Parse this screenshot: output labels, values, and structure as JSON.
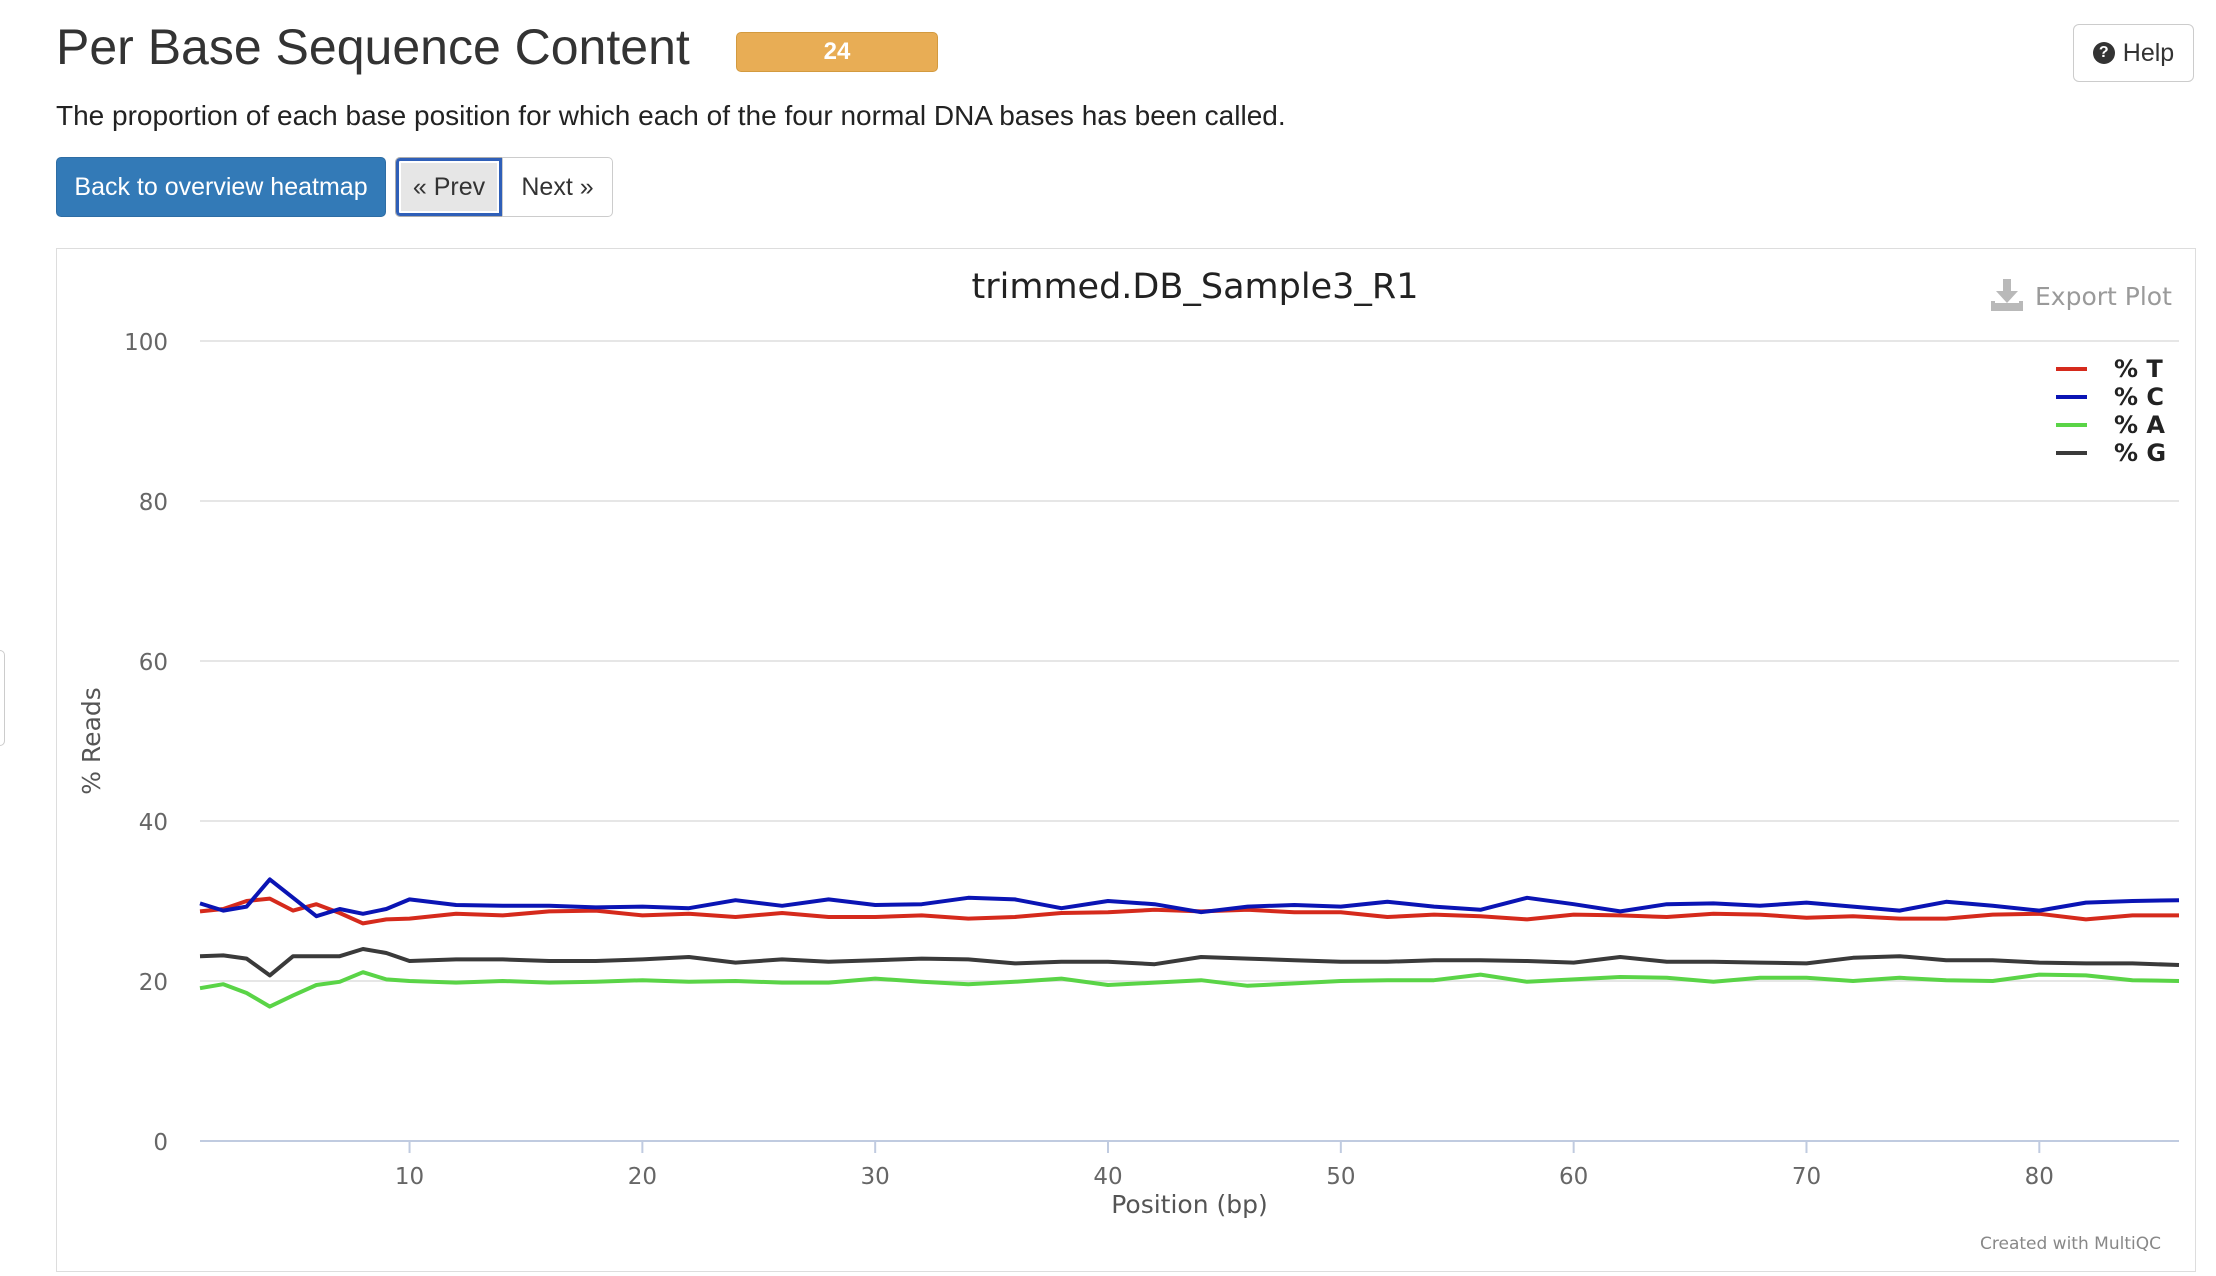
{
  "header": {
    "title": "Per Base Sequence Content",
    "badge": "24",
    "help_label": "Help",
    "description": "The proportion of each base position for which each of the four normal DNA bases has been called."
  },
  "nav": {
    "back_label": "Back to overview heatmap",
    "prev_label": "« Prev",
    "next_label": "Next »"
  },
  "plot": {
    "export_label": "Export Plot",
    "credit": "Created with MultiQC"
  },
  "colors": {
    "T": "#d52a1c",
    "C": "#0a14b4",
    "A": "#5ad447",
    "G": "#3a3a3a"
  },
  "chart_data": {
    "type": "line",
    "title": "trimmed.DB_Sample3_R1",
    "xlabel": "Position (bp)",
    "ylabel": "% Reads",
    "xlim": [
      1,
      86
    ],
    "ylim": [
      0,
      100
    ],
    "xticks": [
      10,
      20,
      30,
      40,
      50,
      60,
      70,
      80
    ],
    "yticks": [
      0,
      20,
      40,
      60,
      80,
      100
    ],
    "grid": true,
    "legend_position": "top-right",
    "x": [
      1,
      2,
      3,
      4,
      5,
      6,
      7,
      8,
      9,
      10,
      12,
      14,
      16,
      18,
      20,
      22,
      24,
      26,
      28,
      30,
      32,
      34,
      36,
      38,
      40,
      42,
      44,
      46,
      48,
      50,
      52,
      54,
      56,
      58,
      60,
      62,
      64,
      66,
      68,
      70,
      72,
      74,
      76,
      78,
      80,
      82,
      84,
      86
    ],
    "series": [
      {
        "name": "% T",
        "color_key": "T",
        "values": [
          28.7,
          29.0,
          30.0,
          30.3,
          28.8,
          29.6,
          28.5,
          27.2,
          27.7,
          27.8,
          28.4,
          28.2,
          28.7,
          28.8,
          28.2,
          28.4,
          28.0,
          28.5,
          28.0,
          28.0,
          28.2,
          27.8,
          28.0,
          28.5,
          28.6,
          28.9,
          28.7,
          28.9,
          28.6,
          28.6,
          28.0,
          28.3,
          28.1,
          27.7,
          28.3,
          28.2,
          28.0,
          28.4,
          28.3,
          27.9,
          28.1,
          27.8,
          27.8,
          28.3,
          28.4,
          27.7,
          28.2,
          28.2
        ]
      },
      {
        "name": "% C",
        "color_key": "C",
        "values": [
          29.7,
          28.8,
          29.3,
          32.7,
          30.4,
          28.1,
          29.0,
          28.4,
          29.0,
          30.2,
          29.5,
          29.4,
          29.4,
          29.2,
          29.3,
          29.1,
          30.1,
          29.4,
          30.2,
          29.5,
          29.6,
          30.4,
          30.2,
          29.1,
          30.0,
          29.6,
          28.6,
          29.3,
          29.5,
          29.3,
          29.9,
          29.3,
          28.9,
          30.4,
          29.6,
          28.7,
          29.6,
          29.7,
          29.4,
          29.8,
          29.3,
          28.8,
          29.9,
          29.4,
          28.8,
          29.8,
          30.0,
          30.1
        ]
      },
      {
        "name": "% A",
        "color_key": "A",
        "values": [
          19.1,
          19.6,
          18.5,
          16.8,
          18.2,
          19.5,
          19.9,
          21.1,
          20.2,
          20.0,
          19.8,
          20.0,
          19.8,
          19.9,
          20.1,
          19.9,
          20.0,
          19.8,
          19.8,
          20.3,
          19.9,
          19.6,
          19.9,
          20.3,
          19.5,
          19.8,
          20.1,
          19.4,
          19.7,
          20.0,
          20.1,
          20.1,
          20.8,
          19.9,
          20.2,
          20.5,
          20.4,
          19.9,
          20.4,
          20.4,
          20.0,
          20.4,
          20.1,
          20.0,
          20.8,
          20.7,
          20.1,
          20.0
        ]
      },
      {
        "name": "% G",
        "color_key": "G",
        "values": [
          23.1,
          23.2,
          22.8,
          20.7,
          23.1,
          23.1,
          23.1,
          24.0,
          23.5,
          22.5,
          22.7,
          22.7,
          22.5,
          22.5,
          22.7,
          23.0,
          22.3,
          22.7,
          22.4,
          22.6,
          22.8,
          22.7,
          22.2,
          22.4,
          22.4,
          22.1,
          23.0,
          22.8,
          22.6,
          22.4,
          22.4,
          22.6,
          22.6,
          22.5,
          22.3,
          23.0,
          22.4,
          22.4,
          22.3,
          22.2,
          22.9,
          23.1,
          22.6,
          22.6,
          22.3,
          22.2,
          22.2,
          22.0
        ]
      }
    ]
  }
}
